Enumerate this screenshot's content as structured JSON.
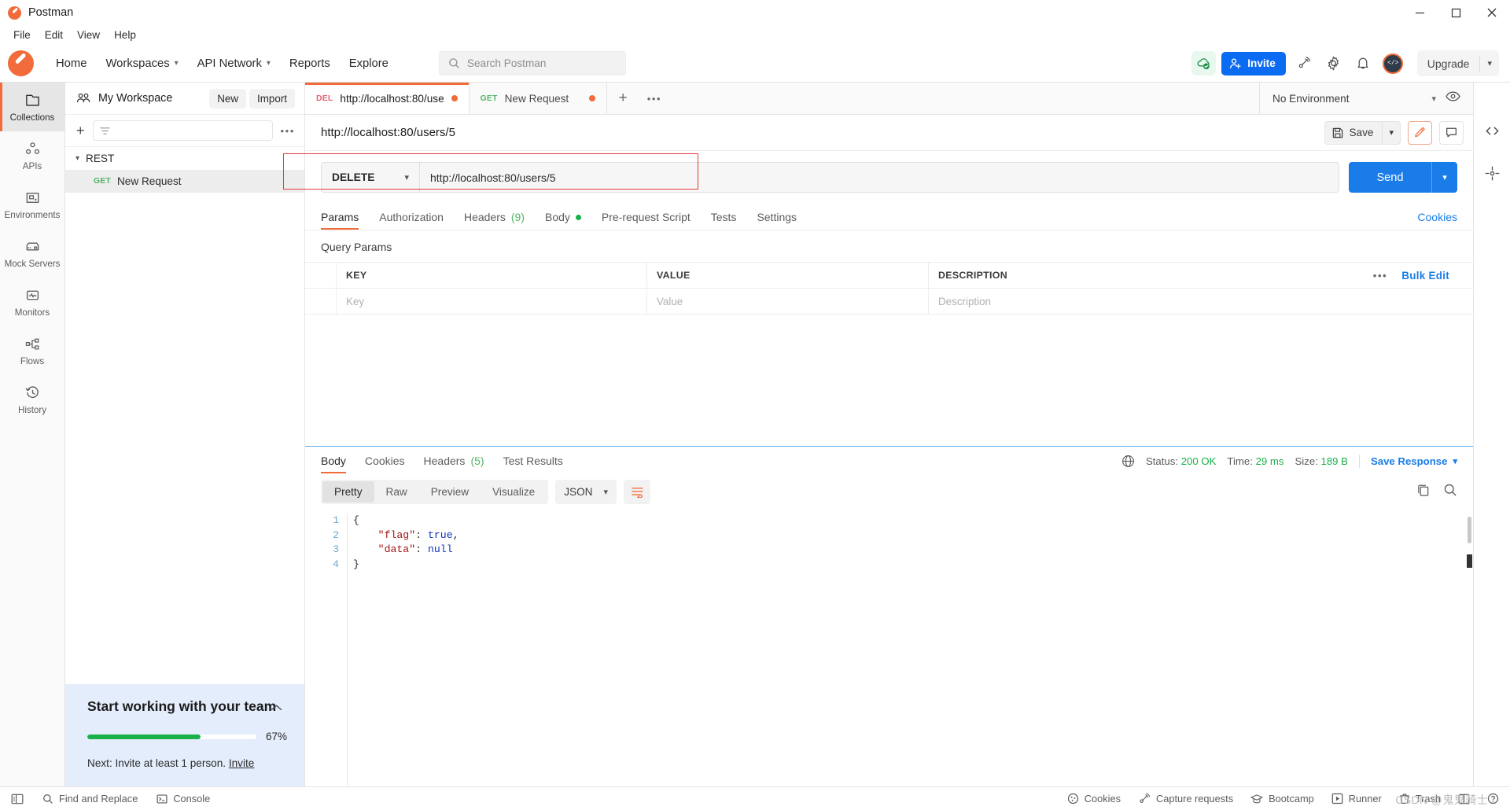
{
  "window": {
    "title": "Postman",
    "controls": {
      "minimize": "minimize-icon",
      "maximize": "maximize-icon",
      "close": "close-icon"
    }
  },
  "menubar": {
    "items": [
      "File",
      "Edit",
      "View",
      "Help"
    ]
  },
  "topnav": {
    "items": [
      {
        "label": "Home",
        "caret": false
      },
      {
        "label": "Workspaces",
        "caret": true
      },
      {
        "label": "API Network",
        "caret": true
      },
      {
        "label": "Reports",
        "caret": false
      },
      {
        "label": "Explore",
        "caret": false
      }
    ],
    "search_placeholder": "Search Postman",
    "invite_label": "Invite",
    "upgrade_label": "Upgrade",
    "icons": [
      "cloud-sync-icon",
      "broadcast-icon",
      "gear-icon",
      "bell-icon",
      "avatar-icon"
    ]
  },
  "rail": {
    "items": [
      {
        "label": "Collections",
        "icon": "collections-icon",
        "active": true
      },
      {
        "label": "APIs",
        "icon": "apis-icon",
        "active": false
      },
      {
        "label": "Environments",
        "icon": "environments-icon",
        "active": false
      },
      {
        "label": "Mock Servers",
        "icon": "mock-servers-icon",
        "active": false
      },
      {
        "label": "Monitors",
        "icon": "monitors-icon",
        "active": false
      },
      {
        "label": "Flows",
        "icon": "flows-icon",
        "active": false
      },
      {
        "label": "History",
        "icon": "history-icon",
        "active": false
      }
    ]
  },
  "sidebar": {
    "workspace_name": "My Workspace",
    "new_label": "New",
    "import_label": "Import",
    "filter_placeholder": "",
    "tree": [
      {
        "type": "collection",
        "label": "REST",
        "expanded": true
      },
      {
        "type": "request",
        "method": "GET",
        "label": "New Request",
        "selected": true
      }
    ],
    "team_card": {
      "title": "Start working with your team",
      "progress_percent": 67,
      "progress_label": "67%",
      "next_text": "Next: Invite at least 1 person.",
      "next_link": "Invite",
      "accent_color": "#19b24a",
      "background": "#e4edfb"
    }
  },
  "tabs": {
    "items": [
      {
        "method": "DEL",
        "title": "http://localhost:80/use",
        "dirty": true,
        "active": true
      },
      {
        "method": "GET",
        "title": "New Request",
        "dirty": true,
        "active": false
      }
    ],
    "new_tab": "+",
    "more": "•••",
    "environment_selected": "No Environment"
  },
  "request": {
    "name": "http://localhost:80/users/5",
    "save_label": "Save",
    "method": "DELETE",
    "url": "http://localhost:80/users/5",
    "send_label": "Send",
    "tabs": [
      {
        "label": "Params",
        "active": true,
        "badge": ""
      },
      {
        "label": "Authorization",
        "active": false,
        "badge": ""
      },
      {
        "label": "Headers",
        "active": false,
        "badge": "(9)"
      },
      {
        "label": "Body",
        "active": false,
        "badge": "",
        "dot": true
      },
      {
        "label": "Pre-request Script",
        "active": false,
        "badge": ""
      },
      {
        "label": "Tests",
        "active": false,
        "badge": ""
      },
      {
        "label": "Settings",
        "active": false,
        "badge": ""
      }
    ],
    "cookies_link": "Cookies",
    "query_params_title": "Query Params",
    "params_table": {
      "headers": [
        "KEY",
        "VALUE",
        "DESCRIPTION"
      ],
      "bulk_edit_label": "Bulk Edit",
      "rows": [
        {
          "key_placeholder": "Key",
          "value_placeholder": "Value",
          "description_placeholder": "Description"
        }
      ]
    }
  },
  "response": {
    "tabs": [
      {
        "label": "Body",
        "active": true,
        "badge": ""
      },
      {
        "label": "Cookies",
        "active": false,
        "badge": ""
      },
      {
        "label": "Headers",
        "active": false,
        "badge": "(5)"
      },
      {
        "label": "Test Results",
        "active": false,
        "badge": ""
      }
    ],
    "status_label": "Status:",
    "status_value": "200 OK",
    "time_label": "Time:",
    "time_value": "29 ms",
    "size_label": "Size:",
    "size_value": "189 B",
    "save_response_label": "Save Response",
    "view_modes": [
      "Pretty",
      "Raw",
      "Preview",
      "Visualize"
    ],
    "active_view_mode": "Pretty",
    "format": "JSON",
    "body_lines": [
      {
        "n": "1",
        "tokens": [
          {
            "t": "{",
            "c": "punct"
          }
        ]
      },
      {
        "n": "2",
        "tokens": [
          {
            "t": "    ",
            "c": "punct"
          },
          {
            "t": "\"flag\"",
            "c": "k-red"
          },
          {
            "t": ": ",
            "c": "punct"
          },
          {
            "t": "true",
            "c": "v-blue"
          },
          {
            "t": ",",
            "c": "punct"
          }
        ]
      },
      {
        "n": "3",
        "tokens": [
          {
            "t": "    ",
            "c": "punct"
          },
          {
            "t": "\"data\"",
            "c": "k-red"
          },
          {
            "t": ": ",
            "c": "punct"
          },
          {
            "t": "null",
            "c": "v-blue"
          }
        ]
      },
      {
        "n": "4",
        "tokens": [
          {
            "t": "}",
            "c": "punct"
          }
        ]
      }
    ]
  },
  "statusbar": {
    "left": [
      {
        "label": "",
        "icon": "sidebar-toggle-icon"
      },
      {
        "label": "Find and Replace",
        "icon": "search-icon"
      },
      {
        "label": "Console",
        "icon": "console-icon"
      }
    ],
    "right": [
      {
        "label": "Cookies",
        "icon": "cookie-icon"
      },
      {
        "label": "Capture requests",
        "icon": "broadcast-icon"
      },
      {
        "label": "Bootcamp",
        "icon": "graduation-cap-icon"
      },
      {
        "label": "Runner",
        "icon": "runner-icon"
      },
      {
        "label": "Trash",
        "icon": "trash-icon"
      },
      {
        "label": "",
        "icon": "layout-icon"
      },
      {
        "label": "",
        "icon": "help-icon"
      }
    ],
    "watermark": "CSDN @鬼鬼骑士"
  },
  "colors": {
    "accent_orange": "#f26b3a",
    "blue": "#1a7ce8",
    "green": "#19b24a",
    "annotation_red": "#e23b3b"
  }
}
